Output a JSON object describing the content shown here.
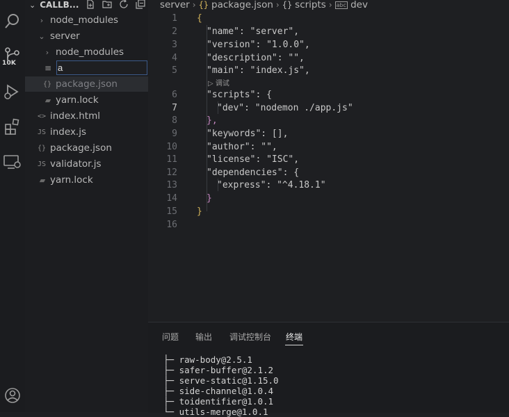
{
  "sidebar": {
    "header_title": "CALLB...",
    "rename_value": "a",
    "items": [
      {
        "label": "node_modules",
        "icon": ""
      },
      {
        "label": "server",
        "icon": ""
      },
      {
        "label": "node_modules",
        "icon": ""
      },
      {
        "label": "package.json",
        "icon": "{}"
      },
      {
        "label": "yarn.lock",
        "icon": ""
      },
      {
        "label": "index.html",
        "icon": "<>"
      },
      {
        "label": "index.js",
        "icon": "JS"
      },
      {
        "label": "package.json",
        "icon": "{}"
      },
      {
        "label": "validator.js",
        "icon": "JS"
      },
      {
        "label": "yarn.lock",
        "icon": ""
      }
    ]
  },
  "activity": {
    "scm_badge": "10K"
  },
  "breadcrumb": {
    "items": [
      "server",
      "package.json",
      "scripts",
      "dev"
    ]
  },
  "editor": {
    "lens": "▷ 调试",
    "lines": [
      {
        "n": "1",
        "t": "{"
      },
      {
        "n": "2",
        "t": "\"name\": \"server\","
      },
      {
        "n": "3",
        "t": "\"version\": \"1.0.0\","
      },
      {
        "n": "4",
        "t": "\"description\": \"\","
      },
      {
        "n": "5",
        "t": "\"main\": \"index.js\","
      },
      {
        "n": "6",
        "t": "\"scripts\": {"
      },
      {
        "n": "7",
        "t": "\"dev\": \"nodemon ./app.js\""
      },
      {
        "n": "8",
        "t": "},"
      },
      {
        "n": "9",
        "t": "\"keywords\": [],"
      },
      {
        "n": "10",
        "t": "\"author\": \"\","
      },
      {
        "n": "11",
        "t": "\"license\": \"ISC\","
      },
      {
        "n": "12",
        "t": "\"dependencies\": {"
      },
      {
        "n": "13",
        "t": "\"express\": \"^4.18.1\""
      },
      {
        "n": "14",
        "t": "}"
      },
      {
        "n": "15",
        "t": "}"
      },
      {
        "n": "16",
        "t": ""
      }
    ]
  },
  "panel": {
    "tabs": [
      "问题",
      "输出",
      "调试控制台",
      "终端"
    ],
    "active_tab": "终端",
    "terminal_lines": [
      "├─ raw-body@2.5.1",
      "├─ safer-buffer@2.1.2",
      "├─ serve-static@1.15.0",
      "├─ side-channel@1.0.4",
      "├─ toidentifier@1.0.1",
      "└─ utils-merge@1.0.1"
    ]
  }
}
